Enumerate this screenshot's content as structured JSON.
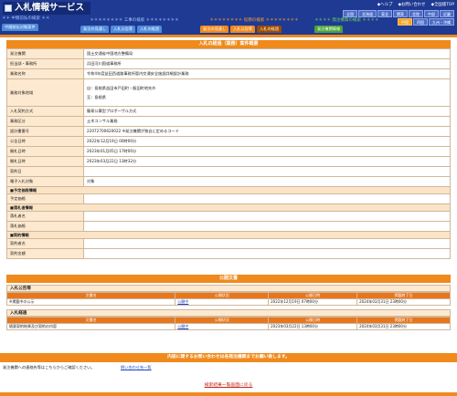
{
  "header": {
    "title": "入札情報サービス",
    "links": [
      "◆ヘルプ",
      "◆お問い合わせ",
      "◆全国版TOP"
    ],
    "regions": [
      "全国",
      "北海道",
      "東北",
      "関東",
      "北陸",
      "中部",
      "近畿"
    ],
    "regions2": [
      "中国",
      "四国",
      "九州・沖縄"
    ]
  },
  "nav": {
    "construction": {
      "title": "＊＊＊＊＊＊＊＊ 工事の検索 ＊＊＊＊＊＊＊＊",
      "tabs": [
        "発注の見通し",
        "入札公告等",
        "入札の経過"
      ]
    },
    "services": {
      "title": "＊＊＊＊＊＊＊＊ 役務の検索 ＊＊＊＊＊＊＊＊",
      "tabs": [
        "発注の見通し",
        "入札公告等",
        "入札の経過"
      ]
    },
    "agencies": {
      "title": "＊＊＊＊ 発注機関の検索 ＊＊＊＊",
      "tabs": [
        "発注機関情報"
      ]
    },
    "header_left": "＊＊ 中間前払の検索 ＊＊",
    "header_left_tab": "中間前払対象案件"
  },
  "detail": {
    "title": "入札の経過（業務）案件概要",
    "rows": [
      {
        "label": "発注機関",
        "value": "国土交通省中国地方整備局"
      },
      {
        "label": "担当部・事務所",
        "value": "浜田河川国道事務所"
      },
      {
        "label": "業務名称",
        "value": "令和4年度益田西道路事務所管内交通安全施設詳細設計業務"
      },
      {
        "label": "業務対象地域",
        "value": "自：島根県益田市戸田町・飯田町地先外\n至：島根県"
      },
      {
        "label": "入札契約方式",
        "value": "簡易公募型プロポーザル方式"
      },
      {
        "label": "業務区分",
        "value": "土木コンサル業務"
      },
      {
        "label": "設計書番号",
        "value": "22072700620022     ※発注機関が独自に定めるコード"
      },
      {
        "label": "公告日時",
        "value": "2022年12月19日 00時00分"
      },
      {
        "label": "開札日時",
        "value": "2023年01月05日 17時00分"
      },
      {
        "label": "開札日時",
        "value": "2023年03月22日 13時32分"
      },
      {
        "label": "契約日",
        "value": ""
      },
      {
        "label": "電子入札対象",
        "value": "対象"
      }
    ],
    "sections": {
      "estimate": "■予定価格情報",
      "estimate_row": "予定価格",
      "bidder": "■落札者情報",
      "bidder_rows": [
        "落札者名",
        "落札価格"
      ],
      "contract": "■契約情報",
      "contract_rows": [
        "契約者名",
        "契約金額"
      ]
    }
  },
  "public_docs": {
    "title": "公開文書",
    "notice": {
      "heading": "入札公告等",
      "columns": [
        "文書名",
        "公開状況",
        "公開日時",
        "掲載終了日"
      ],
      "rows": [
        {
          "name": "※掲載中の公示",
          "status": "公開中",
          "date": "2022年12月19日 07時00分",
          "end": "2024年03月31日 23時00分"
        }
      ]
    },
    "progress": {
      "heading": "入札経過",
      "columns": [
        "文書名",
        "公開状況",
        "公開日時",
        "掲載終了日"
      ],
      "rows": [
        {
          "name": "随意契約結果及び契約の内容",
          "status": "公開中",
          "date": "2023年03月22日 13時00分",
          "end": "2024年03月31日 23時00分"
        }
      ]
    }
  },
  "contact": {
    "bar": "内容に関するお問い合わせは各発注機関までお願い致します。",
    "left": "発注機関への連絡先等はこちらからご確認ください。",
    "link": "問い合わせ先一覧"
  },
  "footer": {
    "back": "検索結果一覧画面に戻る"
  },
  "colors": {
    "header_bg": "#1f3a93",
    "accent_orange": "#f08a1c",
    "label_bg": "#fde9d0"
  }
}
